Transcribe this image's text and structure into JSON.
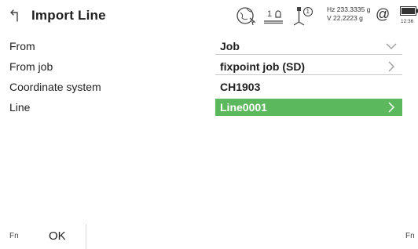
{
  "header": {
    "title": "Import Line",
    "icons": [
      "back-arrow-icon",
      "globe-position-icon",
      "tilt-level-icon",
      "rover-antenna-icon",
      "at-sign-icon",
      "battery-icon"
    ],
    "level_text": "1",
    "rover_number": "1",
    "hz": "Hz 233.3335 g",
    "v": "V  22.2223 g",
    "at": "@",
    "time": "12:36"
  },
  "form": {
    "from_label": "From",
    "from_value": "Job",
    "fromjob_label": "From job",
    "fromjob_value": "fixpoint job (SD)",
    "coord_label": "Coordinate system",
    "coord_value": "CH1903",
    "line_label": "Line",
    "line_value": "Line0001"
  },
  "footer": {
    "fn_left": "Fn",
    "ok": "OK",
    "fn_right": "Fn"
  },
  "colors": {
    "selection": "#5cb85c",
    "text": "#1e1e1e"
  }
}
